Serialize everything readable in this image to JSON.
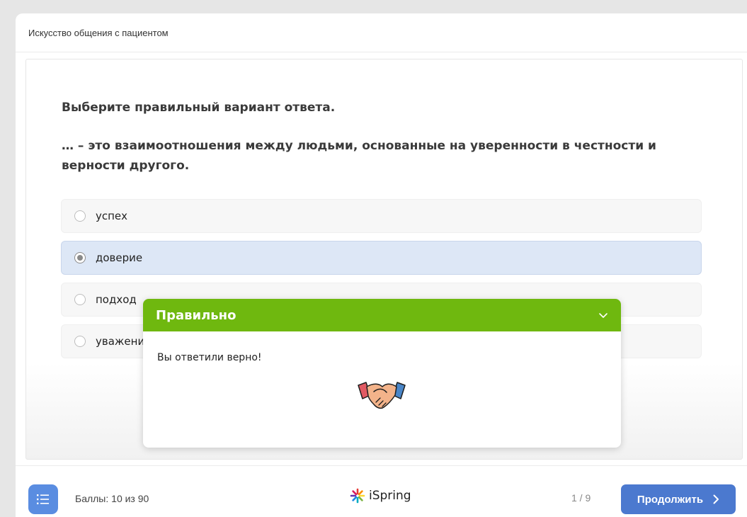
{
  "header": {
    "title": "Искусство общения с пациентом"
  },
  "question": {
    "instruction": "Выберите правильный вариант ответа.",
    "text": "… – это взаимоотношения между людьми, основанные на уверенности в честности и верности другого.",
    "options": [
      {
        "label": "успех",
        "selected": false
      },
      {
        "label": "доверие",
        "selected": true
      },
      {
        "label": "подход",
        "selected": false
      },
      {
        "label": "уважение",
        "selected": false
      }
    ]
  },
  "feedback": {
    "title": "Правильно",
    "message": "Вы ответили верно!",
    "color": "#6fb80f",
    "icons": {
      "collapse": "chevron-down-icon",
      "image": "handshake-icon"
    }
  },
  "footer": {
    "score": "Баллы: 10 из 90",
    "brand": "iSpring",
    "page": "1 / 9",
    "continue_label": "Продолжить",
    "accent": "#4b79cf",
    "icons": {
      "menu": "list-icon",
      "brand": "ispring-logo-icon",
      "next": "chevron-right-icon"
    }
  }
}
